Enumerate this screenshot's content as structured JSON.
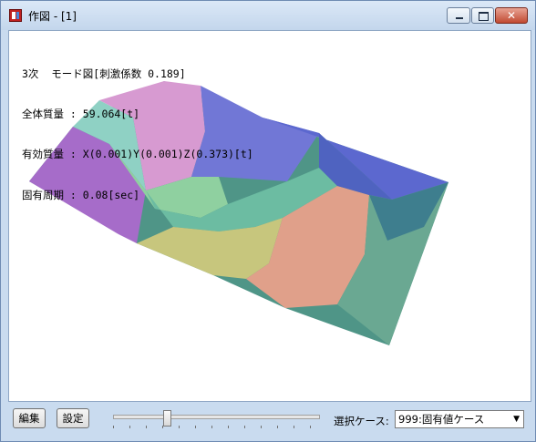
{
  "window": {
    "title": "作図 - [1]"
  },
  "info": {
    "line1": "3次  モード図[刺激係数 0.189]",
    "line2": "全体質量 : 59.064[t]",
    "line3": "有効質量 : X(0.001)Y(0.001)Z(0.373)[t]",
    "line4": "固有周期 : 0.08[sec]"
  },
  "toolbar": {
    "edit_label": "編集",
    "settings_label": "設定"
  },
  "slider": {
    "value_fraction": 0.26
  },
  "case": {
    "label": "選択ケース:",
    "selected": "999:固有値ケース"
  },
  "icons": {
    "app": "app-icon",
    "minimize": "minimize-icon",
    "maximize": "maximize-icon",
    "close": "close-icon"
  }
}
